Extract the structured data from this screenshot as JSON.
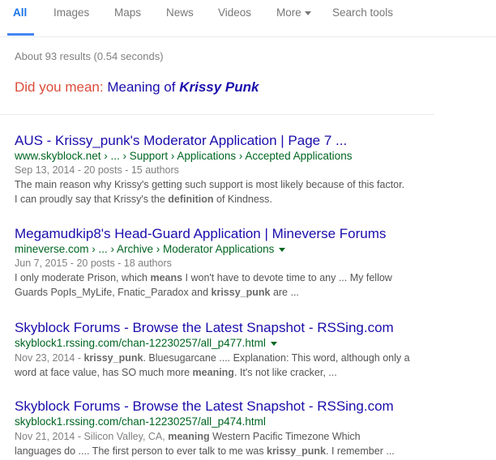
{
  "tabs": [
    {
      "label": "All"
    },
    {
      "label": "Images"
    },
    {
      "label": "Maps"
    },
    {
      "label": "News"
    },
    {
      "label": "Videos"
    },
    {
      "label": "More"
    },
    {
      "label": "Search tools"
    }
  ],
  "stats": "About 93 results (0.54 seconds)",
  "did_you_mean": {
    "label": "Did you mean:",
    "plain": "Meaning of",
    "bold": "Krissy Punk"
  },
  "colors": {
    "link": "#1a0dab",
    "url": "#006621",
    "accent": "#4285f4",
    "correction": "#dd4b39"
  },
  "results": [
    {
      "title": "AUS - Krissy_punk's Moderator Application | Page 7 ...",
      "url": "www.skyblock.net › ... › Support › Applications › Accepted Applications",
      "meta": "Sep 13, 2014 - 20 posts - 15 authors",
      "snippet_1": "The main reason why Krissy's getting such support is most likely because of this factor.",
      "snippet_2a": "I can proudly say that Krissy's the ",
      "snippet_2b": "definition",
      "snippet_2c": " of Kindness."
    },
    {
      "title": "Megamudkip8's Head-Guard Application | Mineverse Forums",
      "url": "mineverse.com › ... › Archive › Moderator Applications",
      "meta": "Jun 7, 2015 - 20 posts - 18 authors",
      "snippet_1a": "I only moderate Prison, which ",
      "snippet_1b": "means",
      "snippet_1c": " I won't have to devote time to any ... My fellow",
      "snippet_2a": "Guards PopIs_MyLife, Fnatic_Paradox and ",
      "snippet_2b": "krissy_punk",
      "snippet_2c": " are ..."
    },
    {
      "title": "Skyblock Forums - Browse the Latest Snapshot - RSSing.com",
      "url": "skyblock1.rssing.com/chan-12230257/all_p477.html",
      "meta": "Nov 23, 2014 - ",
      "snippet_1b": "krissy_punk",
      "snippet_1c": ". Bluesugarcane .... Explanation: This word, although only a",
      "snippet_2a": "word at face value, has SO much more ",
      "snippet_2b": "meaning",
      "snippet_2c": ". It's not like cracker, ..."
    },
    {
      "title": "Skyblock Forums - Browse the Latest Snapshot - RSSing.com",
      "url": "skyblock1.rssing.com/chan-12230257/all_p474.html",
      "meta": "Nov 21, 2014 - Silicon Valley, CA, ",
      "snippet_1b": "meaning",
      "snippet_1c": " Western Pacific Timezone Which",
      "snippet_2a": "languages do .... The first person to ever talk to me was ",
      "snippet_2b": "krissy_punk",
      "snippet_2c": ". I remember ..."
    }
  ]
}
